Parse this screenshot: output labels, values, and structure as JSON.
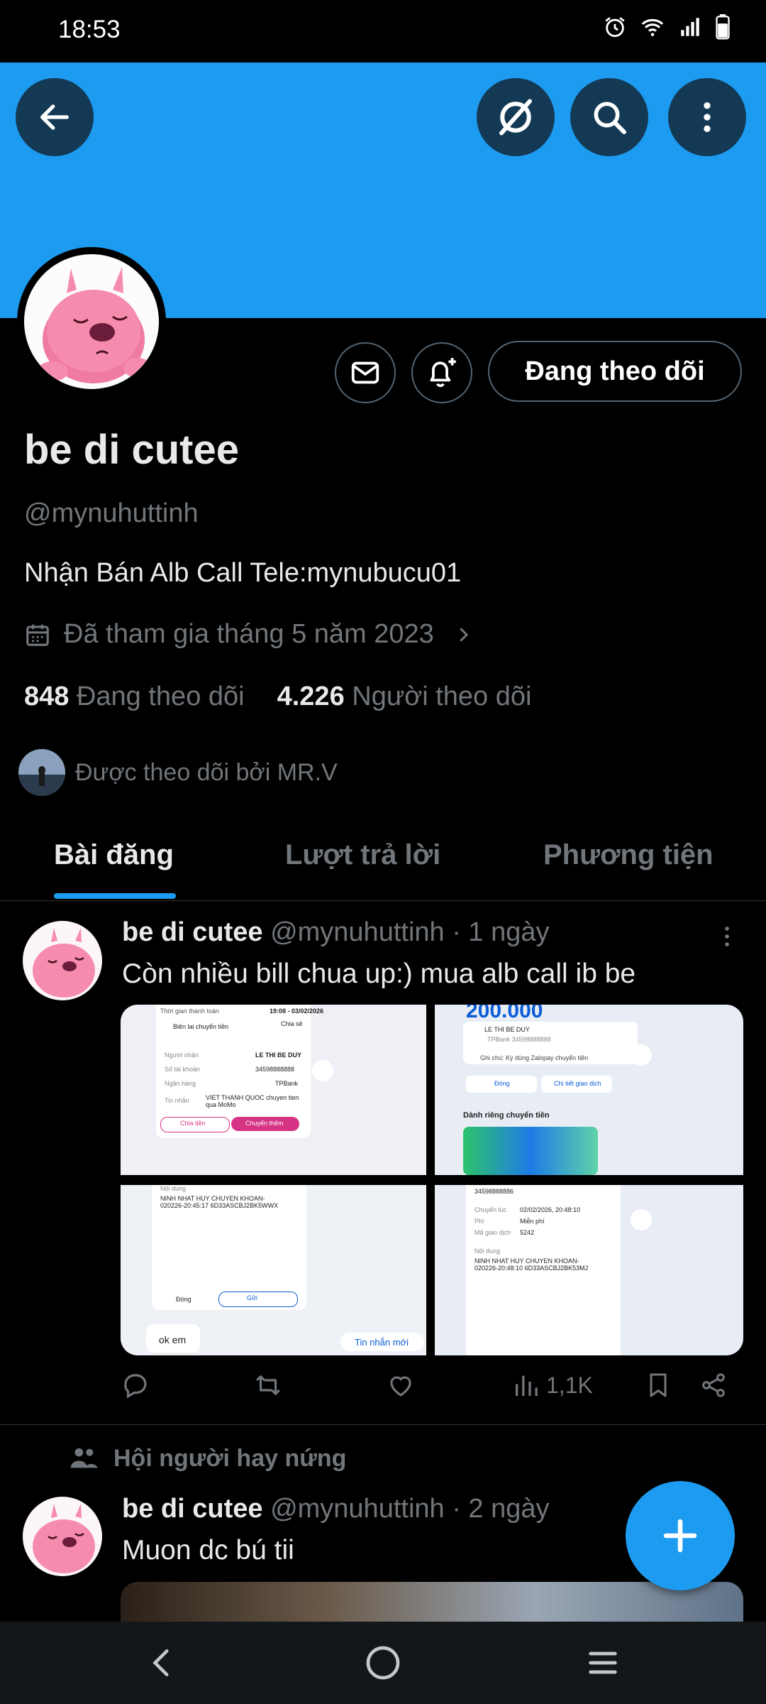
{
  "status_bar": {
    "time": "18:53"
  },
  "profile": {
    "name": "be di cutee",
    "handle": "@mynuhuttinh",
    "bio": "Nhận Bán Alb Call Tele:mynubucu01",
    "joined": "Đã tham gia tháng 5 năm 2023",
    "following_count": "848",
    "following_label": "Đang theo dõi",
    "followers_count": "4.226",
    "followers_label": "Người theo dõi",
    "followed_by": "Được theo dõi bởi MR.V",
    "follow_button": "Đang theo dõi"
  },
  "tabs": [
    {
      "label": "Bài đăng",
      "active": true
    },
    {
      "label": "Lượt trả lời",
      "active": false
    },
    {
      "label": "Phương tiện",
      "active": false
    }
  ],
  "posts": [
    {
      "name": "be di cutee",
      "handle": "@mynuhuttinh",
      "time": "· 1 ngày",
      "text": "Còn nhiều bill chua up:) mua alb call ib be",
      "views": "1,1K",
      "media": {
        "top_left": {
          "header": "Thời gian thanh toán",
          "date": "19:08 - 03/02/2026",
          "title": "Biên lai chuyển tiền",
          "share": "Chia sẻ",
          "recipient_label": "Người nhận",
          "recipient": "LE THI BE DUY",
          "account_label": "Số tài khoản",
          "account": "34598888888",
          "bank_label": "Ngân hàng",
          "bank": "TPBank",
          "message_label": "Tin nhắn",
          "message": "VIET THANH QUOC chuyen tien qua MoMo",
          "btn_split": "Chia tiền",
          "btn_more": "Chuyển thêm"
        },
        "top_right": {
          "amount": "200.000",
          "recipient": "LE THI BE DUY",
          "bank_line": "TPBank 34598888888",
          "note": "Ghi chú: Ký dùng Zalopay chuyển tiền",
          "btn_close": "Đóng",
          "btn_detail": "Chi tiết giao dịch",
          "promo": "Dành riêng chuyển tiền"
        },
        "bottom_left": {
          "content_label": "Nội dung",
          "content": "NINH NHAT HUY CHUYEN KHOAN-020226-20:45:17 6D33ASCBJ2BK5WWX",
          "btn_close": "Đóng",
          "btn_send": "Gửi",
          "reply": "ok em",
          "new_msg": "Tin nhắn mới"
        },
        "bottom_right": {
          "account": "34598888886",
          "time_label": "Chuyển lúc",
          "time": "02/02/2026, 20:48:10",
          "fee_label": "Phí",
          "fee": "Miễn phí",
          "code_label": "Mã giao dịch",
          "code": "5242",
          "content_label": "Nội dung",
          "content": "NINH NHAT HUY CHUYEN KHOAN-020226-20:48:10 6D33ASCBJ2BK53MJ"
        }
      }
    },
    {
      "community": "Hội người hay nứng",
      "name": "be di cutee",
      "handle": "@mynuhuttinh",
      "time": "· 2 ngày",
      "text": "Muon dc bú tii"
    }
  ],
  "colors": {
    "accent": "#1d9bf0",
    "background": "#000000",
    "muted": "#71767b",
    "text": "#e7e9ea"
  },
  "icons": [
    "back-arrow-icon",
    "no-sensitive-icon",
    "search-icon",
    "more-vert-icon",
    "mail-icon",
    "bell-plus-icon",
    "calendar-icon",
    "chevron-right-icon",
    "reply-icon",
    "retweet-icon",
    "like-icon",
    "views-icon",
    "bookmark-icon",
    "share-icon",
    "community-icon",
    "plus-icon",
    "nav-back-icon",
    "nav-home-icon",
    "nav-recents-icon"
  ]
}
